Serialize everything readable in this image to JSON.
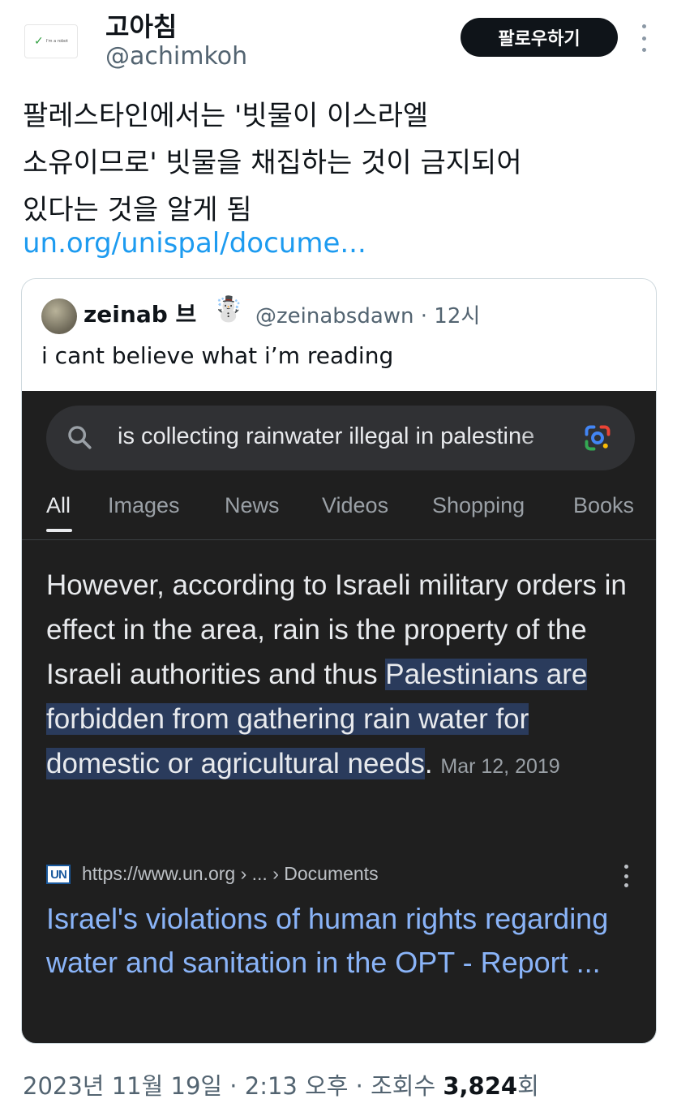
{
  "header": {
    "display_name": "고아침",
    "handle": "@achimkoh",
    "follow_label": "팔로우하기",
    "avatar_text": "I'm a robot"
  },
  "tweet": {
    "text_lines": [
      "팔레스타인에서는 '빗물이 이스라엘",
      "소유이므로' 빗물을 채집하는 것이 금지되어",
      "있다는 것을 알게 됨"
    ],
    "link": "un.org/unispal/docume..."
  },
  "quote": {
    "name": "zeinab 브",
    "emoji": "☃️",
    "handle_time": "@zeinabsdawn · 12시",
    "text": "i cant believe what i’m reading",
    "screenshot": {
      "search_query": "is collecting rainwater illegal in palestine",
      "tabs": [
        "All",
        "Images",
        "News",
        "Videos",
        "Shopping",
        "Books"
      ],
      "snippet_plain": "However, according to Israeli military orders in effect in the area, rain is the property of the Israeli authorities and thus ",
      "snippet_highlight": "Palestinians are forbidden from gathering rain water for domestic or agricultural needs",
      "snippet_end": ".",
      "snippet_date": "Mar 12, 2019",
      "source_logo": "UN",
      "source_url": "https://www.un.org › ... › Documents",
      "result_title": "Israel's violations of human rights regarding water and sanitation in the OPT - Report ..."
    }
  },
  "footer": {
    "meta": "2023년 11월 19일 · 2:13 오후 · 조회수 ",
    "views": "3,824",
    "views_suffix": "회"
  },
  "colors": {
    "link": "#1d9bf0",
    "secondary_text": "#536471",
    "google_bg": "#1f1f1f",
    "google_link": "#8ab4f8",
    "highlight": "#2a3b5c"
  }
}
